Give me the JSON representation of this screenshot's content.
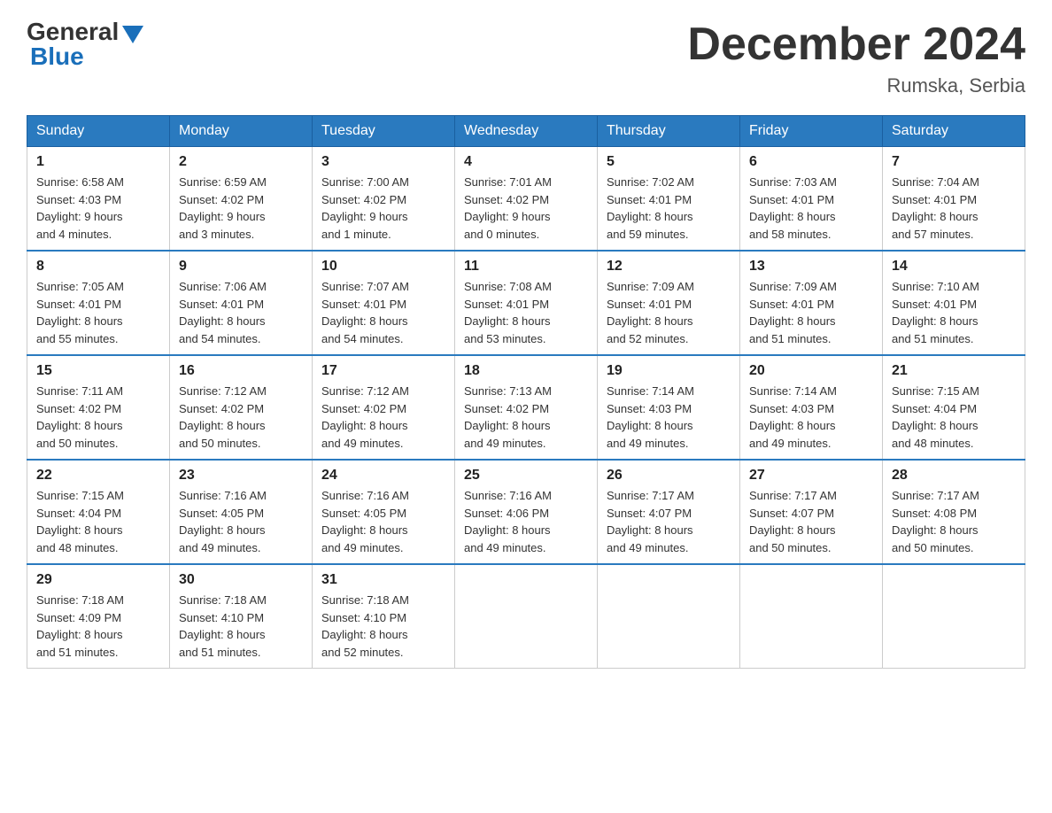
{
  "logo": {
    "general": "General",
    "blue": "Blue"
  },
  "title": "December 2024",
  "subtitle": "Rumska, Serbia",
  "days": [
    "Sunday",
    "Monday",
    "Tuesday",
    "Wednesday",
    "Thursday",
    "Friday",
    "Saturday"
  ],
  "weeks": [
    [
      {
        "day": "1",
        "sunrise": "Sunrise: 6:58 AM",
        "sunset": "Sunset: 4:03 PM",
        "daylight": "Daylight: 9 hours",
        "daylight2": "and 4 minutes."
      },
      {
        "day": "2",
        "sunrise": "Sunrise: 6:59 AM",
        "sunset": "Sunset: 4:02 PM",
        "daylight": "Daylight: 9 hours",
        "daylight2": "and 3 minutes."
      },
      {
        "day": "3",
        "sunrise": "Sunrise: 7:00 AM",
        "sunset": "Sunset: 4:02 PM",
        "daylight": "Daylight: 9 hours",
        "daylight2": "and 1 minute."
      },
      {
        "day": "4",
        "sunrise": "Sunrise: 7:01 AM",
        "sunset": "Sunset: 4:02 PM",
        "daylight": "Daylight: 9 hours",
        "daylight2": "and 0 minutes."
      },
      {
        "day": "5",
        "sunrise": "Sunrise: 7:02 AM",
        "sunset": "Sunset: 4:01 PM",
        "daylight": "Daylight: 8 hours",
        "daylight2": "and 59 minutes."
      },
      {
        "day": "6",
        "sunrise": "Sunrise: 7:03 AM",
        "sunset": "Sunset: 4:01 PM",
        "daylight": "Daylight: 8 hours",
        "daylight2": "and 58 minutes."
      },
      {
        "day": "7",
        "sunrise": "Sunrise: 7:04 AM",
        "sunset": "Sunset: 4:01 PM",
        "daylight": "Daylight: 8 hours",
        "daylight2": "and 57 minutes."
      }
    ],
    [
      {
        "day": "8",
        "sunrise": "Sunrise: 7:05 AM",
        "sunset": "Sunset: 4:01 PM",
        "daylight": "Daylight: 8 hours",
        "daylight2": "and 55 minutes."
      },
      {
        "day": "9",
        "sunrise": "Sunrise: 7:06 AM",
        "sunset": "Sunset: 4:01 PM",
        "daylight": "Daylight: 8 hours",
        "daylight2": "and 54 minutes."
      },
      {
        "day": "10",
        "sunrise": "Sunrise: 7:07 AM",
        "sunset": "Sunset: 4:01 PM",
        "daylight": "Daylight: 8 hours",
        "daylight2": "and 54 minutes."
      },
      {
        "day": "11",
        "sunrise": "Sunrise: 7:08 AM",
        "sunset": "Sunset: 4:01 PM",
        "daylight": "Daylight: 8 hours",
        "daylight2": "and 53 minutes."
      },
      {
        "day": "12",
        "sunrise": "Sunrise: 7:09 AM",
        "sunset": "Sunset: 4:01 PM",
        "daylight": "Daylight: 8 hours",
        "daylight2": "and 52 minutes."
      },
      {
        "day": "13",
        "sunrise": "Sunrise: 7:09 AM",
        "sunset": "Sunset: 4:01 PM",
        "daylight": "Daylight: 8 hours",
        "daylight2": "and 51 minutes."
      },
      {
        "day": "14",
        "sunrise": "Sunrise: 7:10 AM",
        "sunset": "Sunset: 4:01 PM",
        "daylight": "Daylight: 8 hours",
        "daylight2": "and 51 minutes."
      }
    ],
    [
      {
        "day": "15",
        "sunrise": "Sunrise: 7:11 AM",
        "sunset": "Sunset: 4:02 PM",
        "daylight": "Daylight: 8 hours",
        "daylight2": "and 50 minutes."
      },
      {
        "day": "16",
        "sunrise": "Sunrise: 7:12 AM",
        "sunset": "Sunset: 4:02 PM",
        "daylight": "Daylight: 8 hours",
        "daylight2": "and 50 minutes."
      },
      {
        "day": "17",
        "sunrise": "Sunrise: 7:12 AM",
        "sunset": "Sunset: 4:02 PM",
        "daylight": "Daylight: 8 hours",
        "daylight2": "and 49 minutes."
      },
      {
        "day": "18",
        "sunrise": "Sunrise: 7:13 AM",
        "sunset": "Sunset: 4:02 PM",
        "daylight": "Daylight: 8 hours",
        "daylight2": "and 49 minutes."
      },
      {
        "day": "19",
        "sunrise": "Sunrise: 7:14 AM",
        "sunset": "Sunset: 4:03 PM",
        "daylight": "Daylight: 8 hours",
        "daylight2": "and 49 minutes."
      },
      {
        "day": "20",
        "sunrise": "Sunrise: 7:14 AM",
        "sunset": "Sunset: 4:03 PM",
        "daylight": "Daylight: 8 hours",
        "daylight2": "and 49 minutes."
      },
      {
        "day": "21",
        "sunrise": "Sunrise: 7:15 AM",
        "sunset": "Sunset: 4:04 PM",
        "daylight": "Daylight: 8 hours",
        "daylight2": "and 48 minutes."
      }
    ],
    [
      {
        "day": "22",
        "sunrise": "Sunrise: 7:15 AM",
        "sunset": "Sunset: 4:04 PM",
        "daylight": "Daylight: 8 hours",
        "daylight2": "and 48 minutes."
      },
      {
        "day": "23",
        "sunrise": "Sunrise: 7:16 AM",
        "sunset": "Sunset: 4:05 PM",
        "daylight": "Daylight: 8 hours",
        "daylight2": "and 49 minutes."
      },
      {
        "day": "24",
        "sunrise": "Sunrise: 7:16 AM",
        "sunset": "Sunset: 4:05 PM",
        "daylight": "Daylight: 8 hours",
        "daylight2": "and 49 minutes."
      },
      {
        "day": "25",
        "sunrise": "Sunrise: 7:16 AM",
        "sunset": "Sunset: 4:06 PM",
        "daylight": "Daylight: 8 hours",
        "daylight2": "and 49 minutes."
      },
      {
        "day": "26",
        "sunrise": "Sunrise: 7:17 AM",
        "sunset": "Sunset: 4:07 PM",
        "daylight": "Daylight: 8 hours",
        "daylight2": "and 49 minutes."
      },
      {
        "day": "27",
        "sunrise": "Sunrise: 7:17 AM",
        "sunset": "Sunset: 4:07 PM",
        "daylight": "Daylight: 8 hours",
        "daylight2": "and 50 minutes."
      },
      {
        "day": "28",
        "sunrise": "Sunrise: 7:17 AM",
        "sunset": "Sunset: 4:08 PM",
        "daylight": "Daylight: 8 hours",
        "daylight2": "and 50 minutes."
      }
    ],
    [
      {
        "day": "29",
        "sunrise": "Sunrise: 7:18 AM",
        "sunset": "Sunset: 4:09 PM",
        "daylight": "Daylight: 8 hours",
        "daylight2": "and 51 minutes."
      },
      {
        "day": "30",
        "sunrise": "Sunrise: 7:18 AM",
        "sunset": "Sunset: 4:10 PM",
        "daylight": "Daylight: 8 hours",
        "daylight2": "and 51 minutes."
      },
      {
        "day": "31",
        "sunrise": "Sunrise: 7:18 AM",
        "sunset": "Sunset: 4:10 PM",
        "daylight": "Daylight: 8 hours",
        "daylight2": "and 52 minutes."
      },
      null,
      null,
      null,
      null
    ]
  ]
}
